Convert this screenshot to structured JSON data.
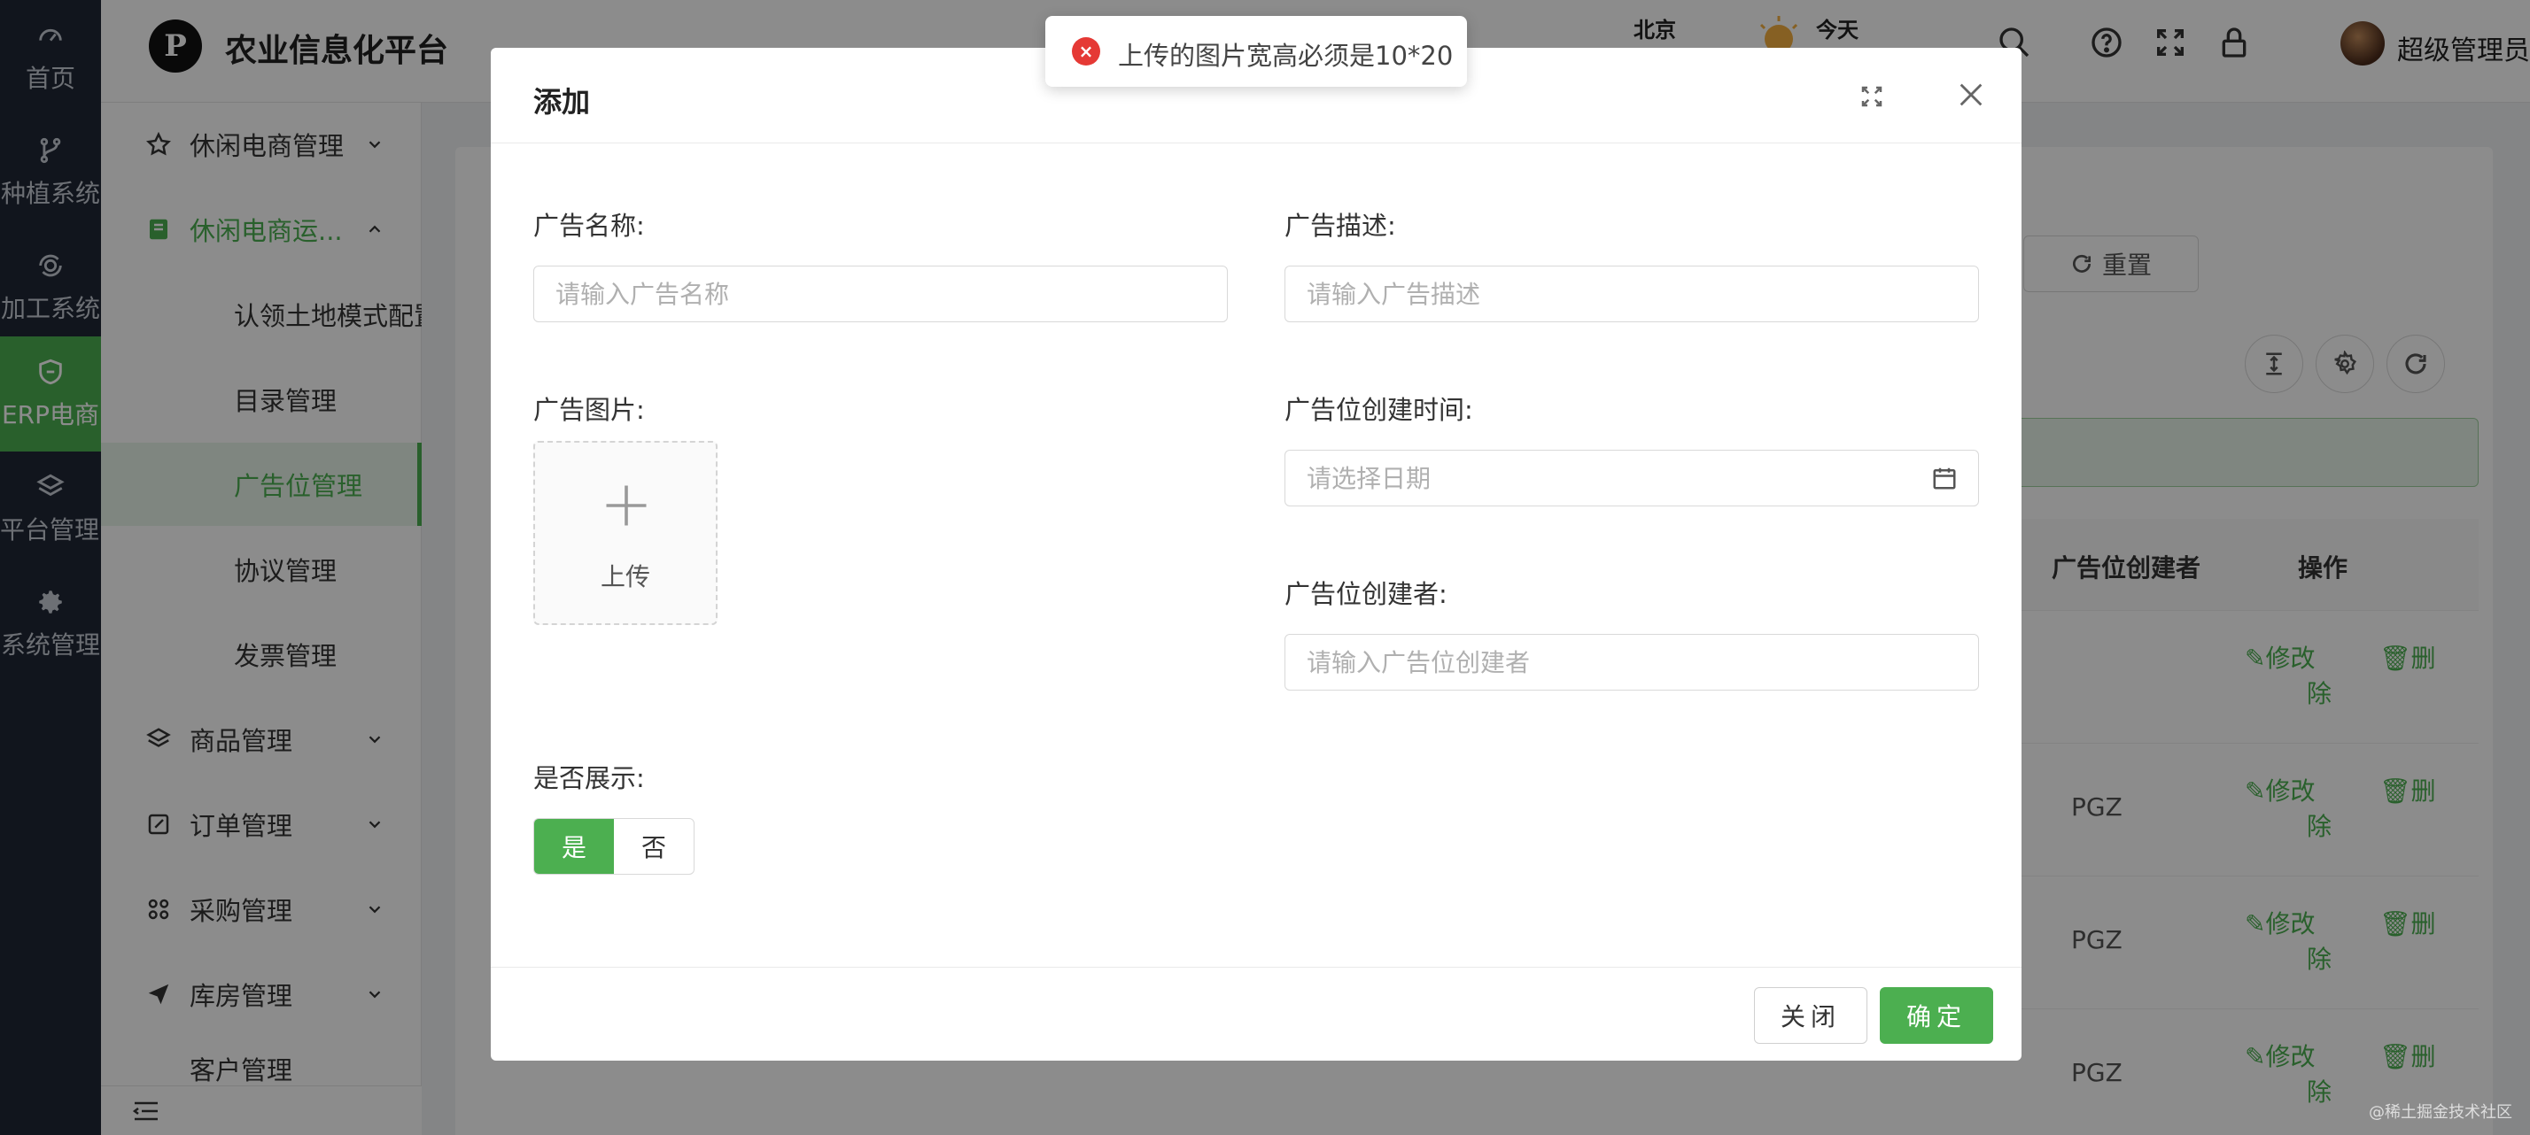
{
  "rail": {
    "items": [
      {
        "label": "首页",
        "icon": "dashboard-icon"
      },
      {
        "label": "种植系统",
        "icon": "branch-icon"
      },
      {
        "label": "加工系统",
        "icon": "process-icon"
      },
      {
        "label": "ERP电商",
        "icon": "shield-icon"
      },
      {
        "label": "平台管理系统",
        "icon": "layers-icon"
      },
      {
        "label": "系统管理",
        "icon": "gear-icon"
      }
    ],
    "active_index": 3
  },
  "header": {
    "logo_letter": "P",
    "title": "农业信息化平台",
    "weather_city": "北京",
    "weather_day": "今天",
    "user_name": "超级管理员"
  },
  "sidebar": {
    "items": [
      {
        "label": "休闲电商管理"
      },
      {
        "label": "休闲电商运..."
      },
      {
        "label": "认领土地模式配置"
      },
      {
        "label": "目录管理"
      },
      {
        "label": "广告位管理"
      },
      {
        "label": "协议管理"
      },
      {
        "label": "发票管理"
      },
      {
        "label": "商品管理"
      },
      {
        "label": "订单管理"
      },
      {
        "label": "采购管理"
      },
      {
        "label": "库房管理"
      },
      {
        "label": "客户管理"
      }
    ]
  },
  "content": {
    "reset_label": "重置",
    "columns": {
      "creator": "广告位创建者",
      "actions": "操作"
    },
    "rows": [
      {
        "creator": "",
        "edit": "修改",
        "del_a": "删",
        "del_b": "除"
      },
      {
        "creator": "PGZ",
        "edit": "修改",
        "del_a": "删",
        "del_b": "除"
      },
      {
        "creator": "PGZ",
        "edit": "修改",
        "del_a": "删",
        "del_b": "除"
      },
      {
        "creator": "PGZ",
        "edit": "修改",
        "del_a": "删",
        "del_b": "除"
      }
    ]
  },
  "modal": {
    "title": "添加",
    "fields": {
      "name_label": "广告名称:",
      "name_placeholder": "请输入广告名称",
      "desc_label": "广告描述:",
      "desc_placeholder": "请输入广告描述",
      "image_label": "广告图片:",
      "upload_label": "上传",
      "created_time_label": "广告位创建时间:",
      "created_time_placeholder": "请选择日期",
      "creator_label": "广告位创建者:",
      "creator_placeholder": "请输入广告位创建者",
      "show_label": "是否展示:",
      "show_yes": "是",
      "show_no": "否"
    },
    "show_selected": "是",
    "close_label": "关闭",
    "ok_label": "确定"
  },
  "toast": {
    "type": "error",
    "message": "上传的图片宽高必须是10*20"
  },
  "watermark": "@稀土掘金技术社区",
  "colors": {
    "primary": "#4caf50",
    "rail_bg": "#1f2735",
    "error": "#e53935"
  }
}
